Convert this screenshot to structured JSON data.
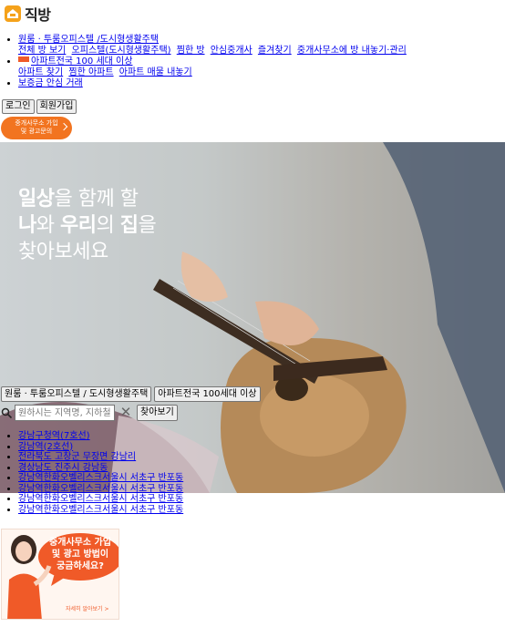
{
  "brand": {
    "name": "직방",
    "color": "#f5a21b"
  },
  "nav": {
    "item1": {
      "label": "원룸 · 투룸오피스텔 /도시형생활주택",
      "sub": [
        "전체 방 보기",
        "오피스텔(도시형생활주택)",
        "찜한 방",
        "안심중개사",
        "즐겨찾기",
        "중개사무소에 방 내놓기·관리"
      ]
    },
    "item2": {
      "label": "아파트전국 100 세대 이상",
      "sub": [
        "아파트 찾기",
        "찜한 아파트",
        "아파트 매물 내놓기"
      ]
    },
    "item3": {
      "label": "보증금 안심 거래"
    }
  },
  "auth": {
    "login": "로그인",
    "signup": "회원가입"
  },
  "agent_pill": {
    "line1": "중개사무소 가입",
    "line2": "및 광고문의"
  },
  "hero": {
    "headline": [
      [
        {
          "t": "일상",
          "b": true
        },
        {
          "t": "을 함께 할",
          "b": false
        }
      ],
      [
        {
          "t": "나",
          "b": true
        },
        {
          "t": "와 ",
          "b": false
        },
        {
          "t": "우리",
          "b": true
        },
        {
          "t": "의 ",
          "b": false
        },
        {
          "t": "집",
          "b": true
        },
        {
          "t": "을",
          "b": false
        }
      ],
      [
        {
          "t": "찾아보세요",
          "b": false
        }
      ]
    ]
  },
  "search": {
    "tabs": [
      "원룸 · 투룸오피스텔 / 도시형생활주택",
      "아파트전국 100세대 이상"
    ],
    "placeholder": "원하시는 지역명, 지하철역",
    "clear": "✕",
    "button": "찾아보기",
    "suggestions": [
      "강남구청역(7호선)",
      "강남역(2호선)",
      "전라북도 고창군 무장면 강남리",
      "경상남도 진주시 강남동",
      "강남역한화오벨리스크서울시 서초구 반포동",
      "강남역한화오벨리스크서울시 서초구 반포동",
      "강남역한화오벨리스크서울시 서초구 반포동",
      "강남역한화오벨리스크서울시 서초구 반포동"
    ]
  },
  "ad": {
    "text": [
      "중개사무소 가입",
      "및 광고 방법이",
      "궁금하세요?"
    ],
    "more": "자세히 알아보기 >",
    "color": "#f05a28"
  }
}
